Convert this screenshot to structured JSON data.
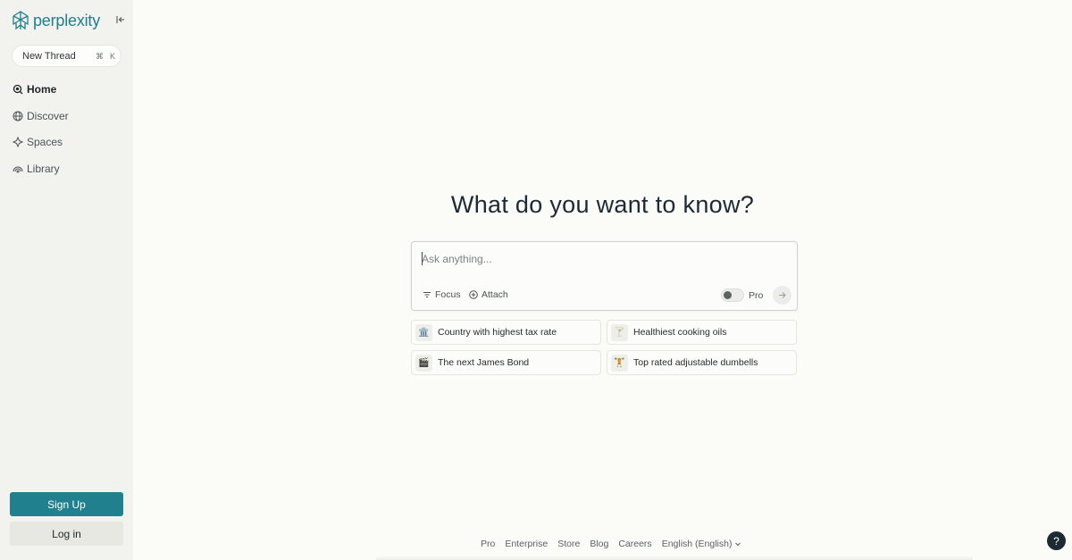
{
  "brand": {
    "name": "perplexity",
    "color": "#20808d"
  },
  "sidebar": {
    "new_thread": {
      "label": "New Thread",
      "shortcut_cmd": "⌘",
      "shortcut_key": "K"
    },
    "items": [
      {
        "label": "Home",
        "icon": "home-search-icon",
        "active": true
      },
      {
        "label": "Discover",
        "icon": "globe-icon",
        "active": false
      },
      {
        "label": "Spaces",
        "icon": "spaces-icon",
        "active": false
      },
      {
        "label": "Library",
        "icon": "library-icon",
        "active": false
      }
    ],
    "signup_label": "Sign Up",
    "login_label": "Log in"
  },
  "main": {
    "headline": "What do you want to know?",
    "ask": {
      "placeholder": "Ask anything...",
      "focus_label": "Focus",
      "attach_label": "Attach",
      "pro_label": "Pro",
      "pro_enabled": false
    },
    "suggestions": [
      {
        "emoji": "🏛️",
        "label": "Country with highest tax rate"
      },
      {
        "emoji": "🍸",
        "label": "Healthiest cooking oils"
      },
      {
        "emoji": "🎬",
        "label": "The next James Bond"
      },
      {
        "emoji": "🏋️",
        "label": "Top rated adjustable dumbells"
      }
    ]
  },
  "footer": {
    "links": [
      "Pro",
      "Enterprise",
      "Store",
      "Blog",
      "Careers"
    ],
    "language": "English (English)"
  },
  "help_label": "?"
}
